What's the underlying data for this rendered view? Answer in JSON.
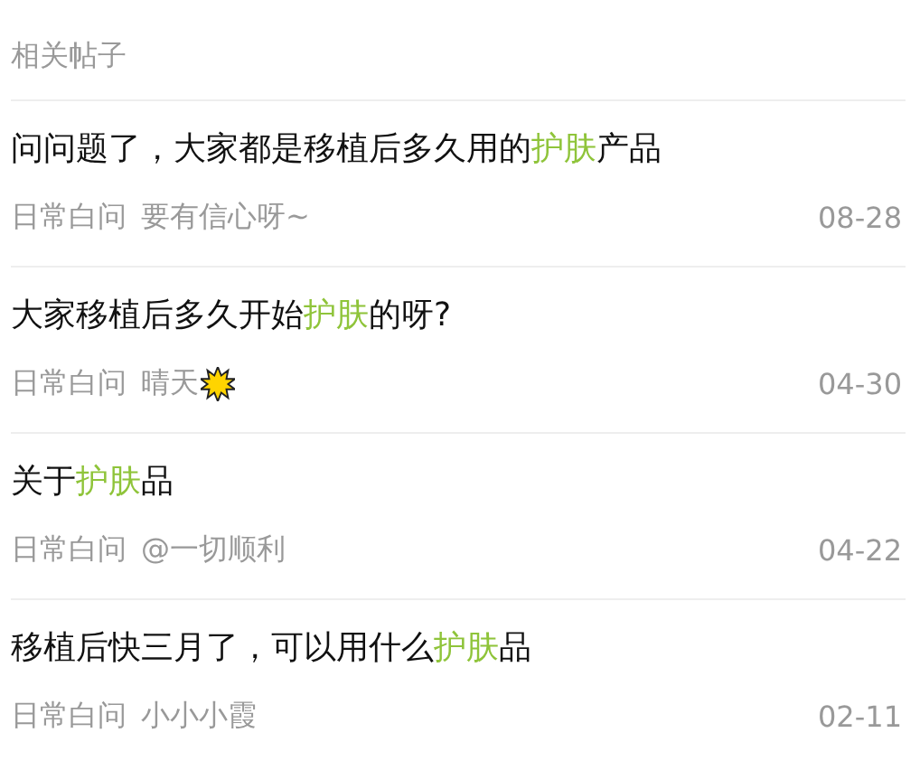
{
  "header": "相关帖子",
  "posts": [
    {
      "title": [
        "问问题了，大家都是移植后多久用的",
        "护肤",
        "产品"
      ],
      "category": "日常白问",
      "author": "要有信心呀~",
      "date": "08-28"
    },
    {
      "title": [
        "大家移植后多久开始",
        "护肤",
        "的呀?"
      ],
      "category": "日常白问",
      "author": "晴天",
      "author_icon": true,
      "date": "04-30"
    },
    {
      "title": [
        "关于",
        "护肤",
        "品"
      ],
      "category": "日常白问",
      "author": "@一切顺利",
      "date": "04-22"
    },
    {
      "title": [
        "移植后快三月了，可以用什么",
        "护肤",
        "品"
      ],
      "category": "日常白问",
      "author": "小小小霞",
      "date": "02-11"
    }
  ]
}
